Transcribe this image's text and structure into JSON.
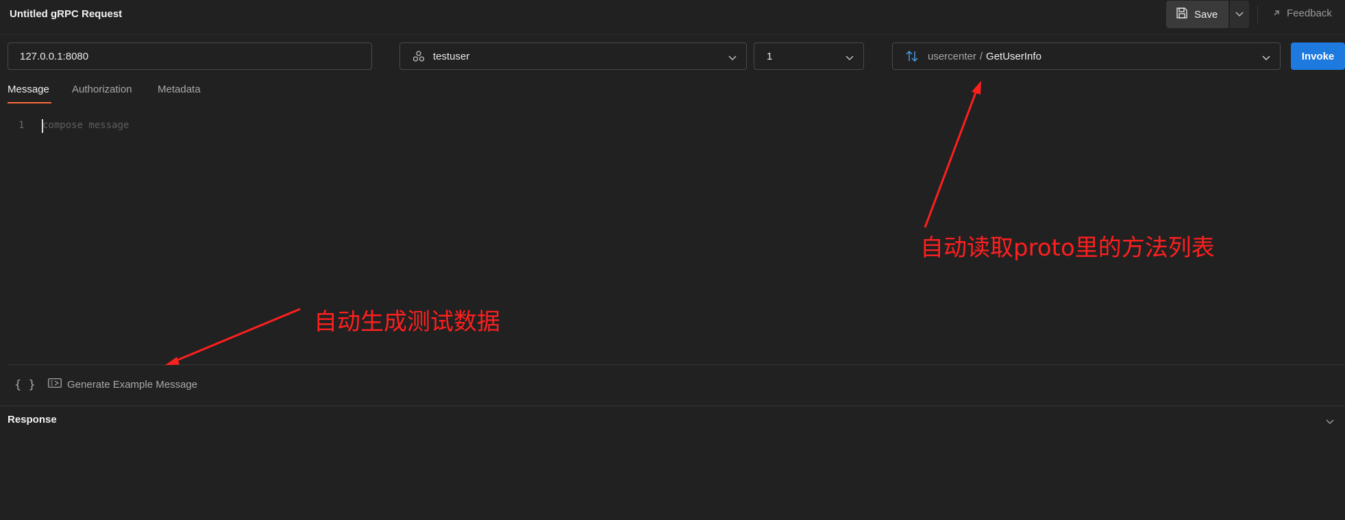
{
  "header": {
    "title": "Untitled gRPC Request",
    "save_label": "Save",
    "feedback_label": "Feedback"
  },
  "request": {
    "url_value": "127.0.0.1:8080",
    "user_value": "testuser",
    "version_value": "1",
    "service": "usercenter",
    "separator": "/",
    "method": "GetUserInfo",
    "invoke_label": "Invoke"
  },
  "tabs": [
    {
      "label": "Message",
      "active": true
    },
    {
      "label": "Authorization",
      "active": false
    },
    {
      "label": "Metadata",
      "active": false
    }
  ],
  "editor": {
    "line_number": "1",
    "placeholder": "compose message"
  },
  "toolbar": {
    "braces_label": "{ }",
    "generate_label": "Generate Example Message"
  },
  "response": {
    "title": "Response"
  },
  "annotations": {
    "method_list_note": "自动读取proto里的方法列表",
    "test_data_note": "自动生成测试数据",
    "color": "#ff1f1f"
  },
  "colors": {
    "accent": "#ff6c37",
    "invoke": "#1f7ae0",
    "background": "#212121"
  }
}
